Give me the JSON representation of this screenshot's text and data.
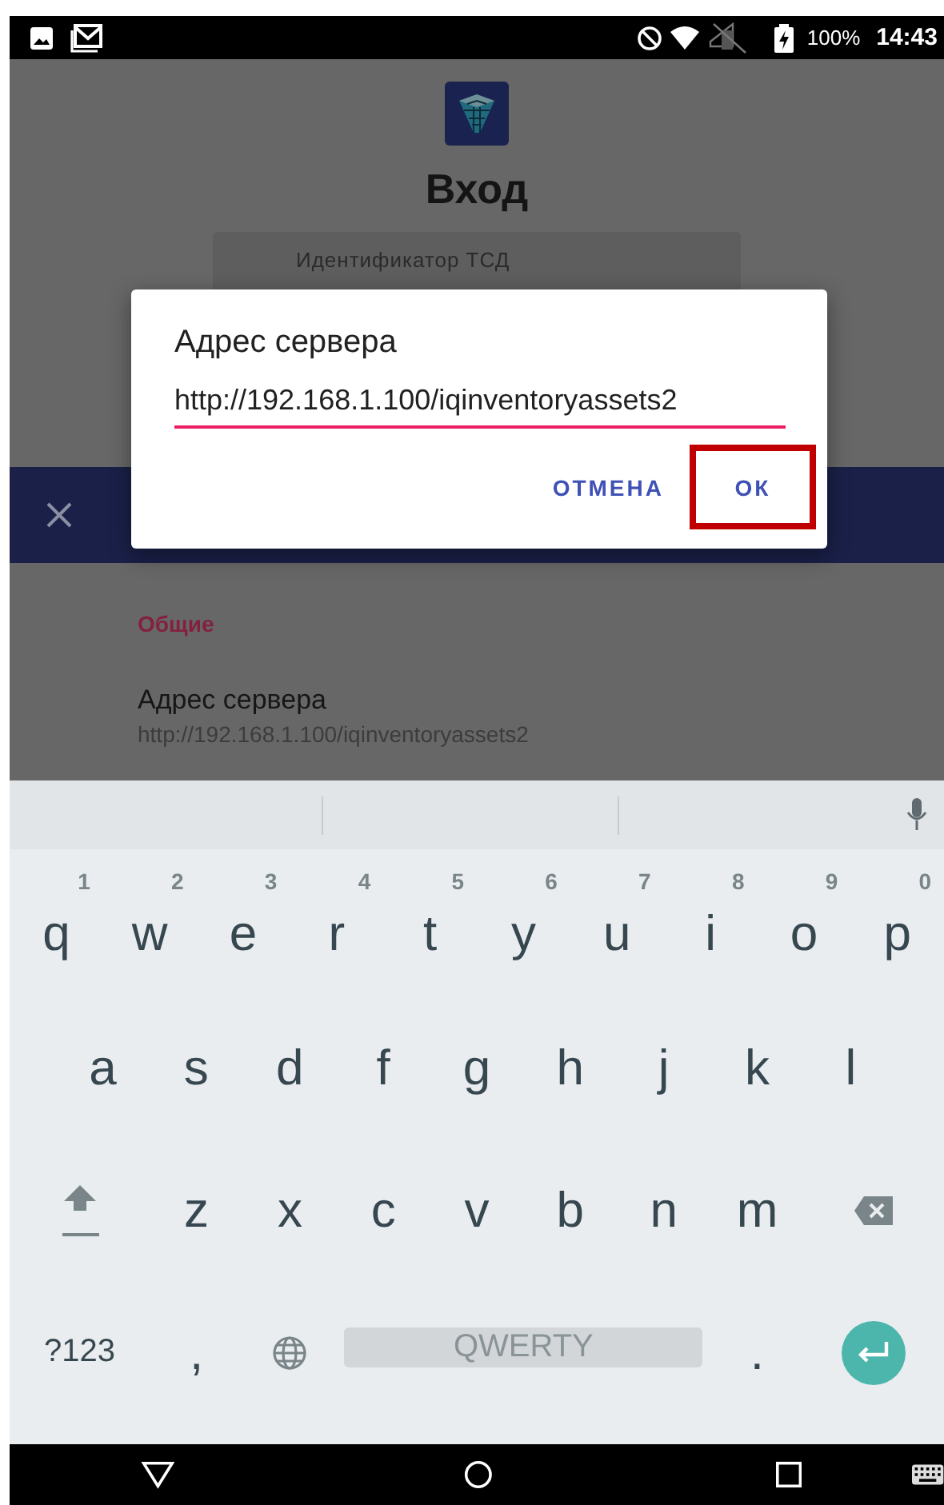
{
  "status_bar": {
    "battery": "100%",
    "time": "14:43"
  },
  "login": {
    "title": "Вход",
    "device_id_label": "Идентификатор ТСД"
  },
  "settings": {
    "section": "Общие",
    "items": [
      {
        "title": "Адрес сервера",
        "value": "http://192.168.1.100/iqinventoryassets2"
      }
    ]
  },
  "dialog": {
    "title": "Адрес сервера",
    "value": "http://192.168.1.100/iqinventoryassets2",
    "buttons": [
      {
        "label": "ОТМЕНА",
        "highlighted": false
      },
      {
        "label": "ОК",
        "highlighted": true
      }
    ]
  },
  "keyboard": {
    "rows": [
      {
        "keys": [
          {
            "kind": "letter",
            "label": "q",
            "hint": "1"
          },
          {
            "kind": "letter",
            "label": "w",
            "hint": "2"
          },
          {
            "kind": "letter",
            "label": "e",
            "hint": "3"
          },
          {
            "kind": "letter",
            "label": "r",
            "hint": "4"
          },
          {
            "kind": "letter",
            "label": "t",
            "hint": "5"
          },
          {
            "kind": "letter",
            "label": "y",
            "hint": "6"
          },
          {
            "kind": "letter",
            "label": "u",
            "hint": "7"
          },
          {
            "kind": "letter",
            "label": "i",
            "hint": "8"
          },
          {
            "kind": "letter",
            "label": "o",
            "hint": "9"
          },
          {
            "kind": "letter",
            "label": "p",
            "hint": "0"
          }
        ]
      },
      {
        "keys": [
          {
            "kind": "letter",
            "label": "a"
          },
          {
            "kind": "letter",
            "label": "s"
          },
          {
            "kind": "letter",
            "label": "d"
          },
          {
            "kind": "letter",
            "label": "f"
          },
          {
            "kind": "letter",
            "label": "g"
          },
          {
            "kind": "letter",
            "label": "h"
          },
          {
            "kind": "letter",
            "label": "j"
          },
          {
            "kind": "letter",
            "label": "k"
          },
          {
            "kind": "letter",
            "label": "l"
          }
        ]
      },
      {
        "keys": [
          {
            "kind": "shift"
          },
          {
            "kind": "letter",
            "label": "z"
          },
          {
            "kind": "letter",
            "label": "x"
          },
          {
            "kind": "letter",
            "label": "c"
          },
          {
            "kind": "letter",
            "label": "v"
          },
          {
            "kind": "letter",
            "label": "b"
          },
          {
            "kind": "letter",
            "label": "n"
          },
          {
            "kind": "letter",
            "label": "m"
          },
          {
            "kind": "backspace"
          }
        ]
      },
      {
        "keys": [
          {
            "kind": "symbols",
            "label": "?123"
          },
          {
            "kind": "letter",
            "label": ","
          },
          {
            "kind": "globe"
          },
          {
            "kind": "space",
            "label": "QWERTY"
          },
          {
            "kind": "letter",
            "label": "."
          },
          {
            "kind": "enter"
          }
        ]
      }
    ]
  }
}
